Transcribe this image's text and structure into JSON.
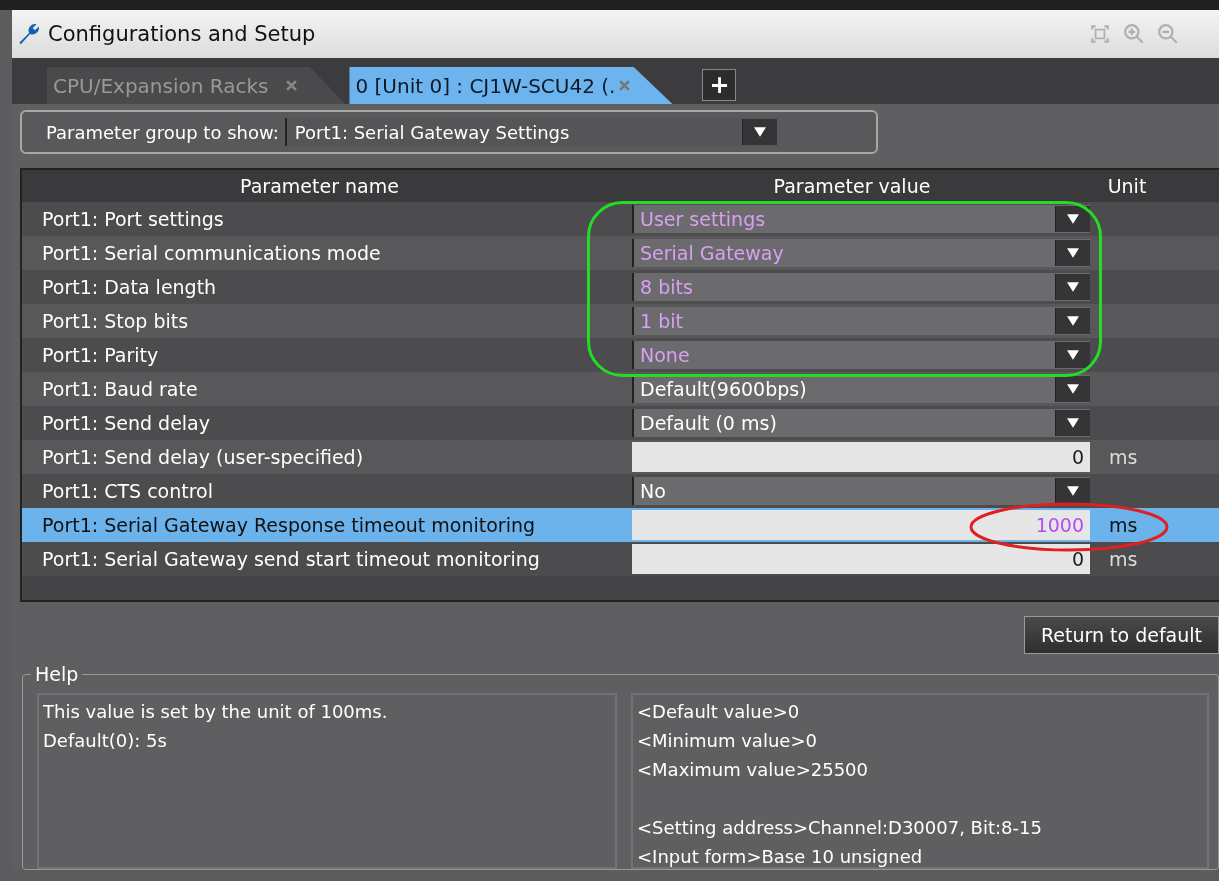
{
  "window": {
    "title": "Configurations and Setup"
  },
  "tabs": [
    {
      "label": "CPU/Expansion Racks",
      "selected": false
    },
    {
      "label": "0 [Unit 0] : CJ1W-SCU42 (.",
      "selected": true
    }
  ],
  "add_tab": "+",
  "parameter_group": {
    "label": "Parameter group to show:",
    "value": "Port1: Serial Gateway Settings"
  },
  "table": {
    "columns": [
      "Parameter name",
      "Parameter value",
      "Unit"
    ],
    "rows": [
      {
        "name": "Port1: Port settings",
        "kind": "dropdown",
        "value": "User settings",
        "changed": true,
        "selected": false,
        "boxed": true,
        "circled": false
      },
      {
        "name": "Port1: Serial communications mode",
        "kind": "dropdown",
        "value": "Serial Gateway",
        "changed": true,
        "selected": false,
        "boxed": true,
        "circled": false
      },
      {
        "name": "Port1: Data length",
        "kind": "dropdown",
        "value": "8 bits",
        "changed": true,
        "selected": false,
        "boxed": true,
        "circled": false
      },
      {
        "name": "Port1: Stop bits",
        "kind": "dropdown",
        "value": "1 bit",
        "changed": true,
        "selected": false,
        "boxed": true,
        "circled": false
      },
      {
        "name": "Port1: Parity",
        "kind": "dropdown",
        "value": "None",
        "changed": true,
        "selected": false,
        "boxed": true,
        "circled": false
      },
      {
        "name": "Port1: Baud rate",
        "kind": "dropdown",
        "value": "Default(9600bps)",
        "changed": false,
        "selected": false,
        "boxed": false,
        "circled": false
      },
      {
        "name": "Port1: Send delay",
        "kind": "dropdown",
        "value": "Default (0 ms)",
        "changed": false,
        "selected": false,
        "boxed": false,
        "circled": false
      },
      {
        "name": "Port1: Send delay (user-specified)",
        "kind": "number",
        "value": "0",
        "unit": "ms",
        "changed": false,
        "selected": false,
        "boxed": false,
        "circled": false
      },
      {
        "name": "Port1: CTS control",
        "kind": "dropdown",
        "value": "No",
        "changed": false,
        "selected": false,
        "boxed": false,
        "circled": false
      },
      {
        "name": "Port1: Serial Gateway Response timeout monitoring",
        "kind": "number",
        "value": "1000",
        "unit": "ms",
        "changed": true,
        "selected": true,
        "boxed": false,
        "circled": true
      },
      {
        "name": "Port1: Serial Gateway send start timeout monitoring",
        "kind": "number",
        "value": "0",
        "unit": "ms",
        "changed": false,
        "selected": false,
        "boxed": false,
        "circled": false
      }
    ]
  },
  "return_button": "Return to default",
  "help": {
    "title": "Help",
    "description": [
      "This value is set by the unit of 100ms.",
      "Default(0): 5s"
    ],
    "details": [
      [
        "<Default value>0",
        "<Minimum value>0",
        "<Maximum value>25500"
      ],
      [
        "<Setting address>Channel:D30007, Bit:8-15",
        "<Input form>Base 10 unsigned"
      ]
    ]
  }
}
